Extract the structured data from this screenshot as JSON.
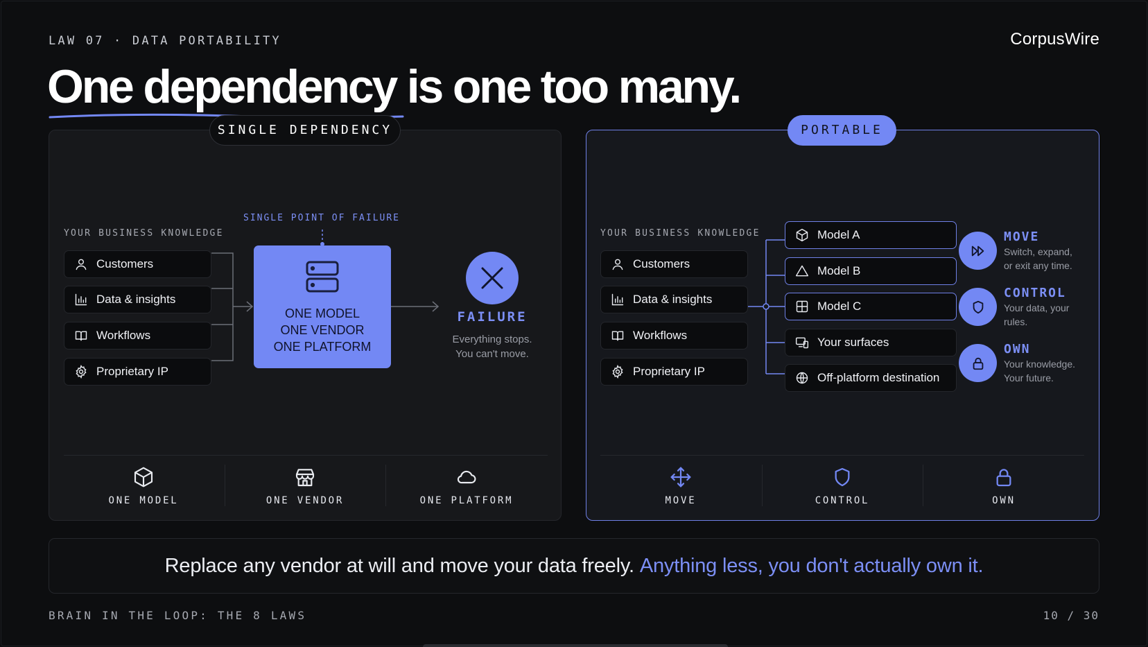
{
  "header": {
    "eyebrow": "LAW 07 · DATA PORTABILITY",
    "brand": "CorpusWire",
    "headline": "One dependency is one too many."
  },
  "left_panel": {
    "badge": "SINGLE DEPENDENCY",
    "knowledge_label": "YOUR BUSINESS KNOWLEDGE",
    "knowledge_items": [
      {
        "label": "Customers",
        "icon": "user-icon"
      },
      {
        "label": "Data & insights",
        "icon": "bar-chart-icon"
      },
      {
        "label": "Workflows",
        "icon": "book-icon"
      },
      {
        "label": "Proprietary IP",
        "icon": "gear-icon"
      }
    ],
    "spof_label": "SINGLE POINT OF FAILURE",
    "central_lines": [
      "ONE MODEL",
      "ONE VENDOR",
      "ONE PLATFORM"
    ],
    "failure_title": "FAILURE",
    "failure_lines": [
      "Everything stops.",
      "You can't move."
    ],
    "footer": [
      {
        "label": "ONE MODEL",
        "icon": "cube-icon"
      },
      {
        "label": "ONE VENDOR",
        "icon": "storefront-icon"
      },
      {
        "label": "ONE PLATFORM",
        "icon": "cloud-icon"
      }
    ]
  },
  "right_panel": {
    "badge": "PORTABLE",
    "knowledge_label": "YOUR BUSINESS KNOWLEDGE",
    "knowledge_items": [
      {
        "label": "Customers",
        "icon": "user-icon"
      },
      {
        "label": "Data & insights",
        "icon": "bar-chart-icon"
      },
      {
        "label": "Workflows",
        "icon": "book-icon"
      },
      {
        "label": "Proprietary IP",
        "icon": "gear-icon"
      }
    ],
    "destinations": [
      {
        "label": "Model A",
        "icon": "cube-icon"
      },
      {
        "label": "Model B",
        "icon": "triangle-icon"
      },
      {
        "label": "Model C",
        "icon": "grid-icon"
      },
      {
        "label": "Your surfaces",
        "icon": "devices-icon"
      },
      {
        "label": "Off-platform destination",
        "icon": "globe-icon"
      }
    ],
    "benefits": [
      {
        "title": "MOVE",
        "lines": [
          "Switch, expand,",
          "or exit any time."
        ],
        "icon": "fast-forward-icon"
      },
      {
        "title": "CONTROL",
        "lines": [
          "Your data, your",
          "rules."
        ],
        "icon": "shield-icon"
      },
      {
        "title": "OWN",
        "lines": [
          "Your knowledge.",
          "Your future."
        ],
        "icon": "lock-icon"
      }
    ],
    "footer": [
      {
        "label": "MOVE",
        "icon": "move-arrows-icon"
      },
      {
        "label": "CONTROL",
        "icon": "shield-icon"
      },
      {
        "label": "OWN",
        "icon": "lock-icon"
      }
    ]
  },
  "callout": {
    "main": "Replace any vendor at will and move your data freely.",
    "accent": "Anything less, you don't actually own it."
  },
  "footer": {
    "deck_title": "BRAIN IN THE LOOP: THE 8 LAWS",
    "page": "10 / 30"
  },
  "colors": {
    "accent": "#7388f4",
    "background": "#0d0e10",
    "panel": "#17181b"
  }
}
